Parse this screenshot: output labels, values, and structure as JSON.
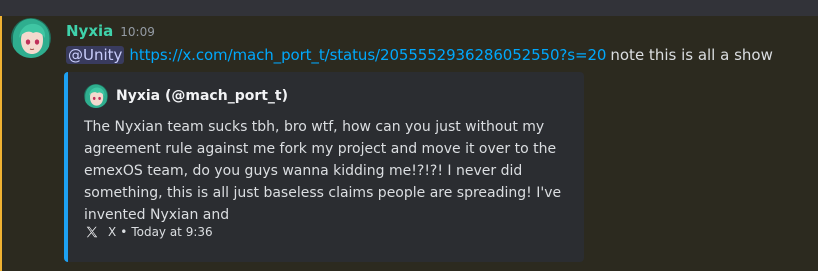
{
  "message": {
    "username": "Nyxia",
    "timestamp": "10:09",
    "mention": "@Unity",
    "link": "https://x.com/mach_port_t/status/2055552936286052550?s=20",
    "trailing_text": "note this is all a show"
  },
  "embed": {
    "author": "Nyxia (@mach_port_t)",
    "text": "The Nyxian team sucks tbh, bro wtf, how can you just without my agreement rule against me fork my project and move it over to the emexOS team, do you guys wanna kidding me!?!?! I never did something, this is all just baseless claims people are spreading! I've invented Nyxian and",
    "footer_source": "X",
    "footer_separator": "•",
    "footer_time": "Today at 9:36"
  },
  "colors": {
    "username": "#3fd2ab",
    "link": "#00a8fc",
    "mention_highlight_bar": "#f0b232",
    "embed_border": "#1da1f2",
    "embed_background": "#2b2d31"
  },
  "icons": {
    "avatar": "user-avatar",
    "author_avatar": "embed-author-avatar",
    "source": "x-logo-icon"
  }
}
